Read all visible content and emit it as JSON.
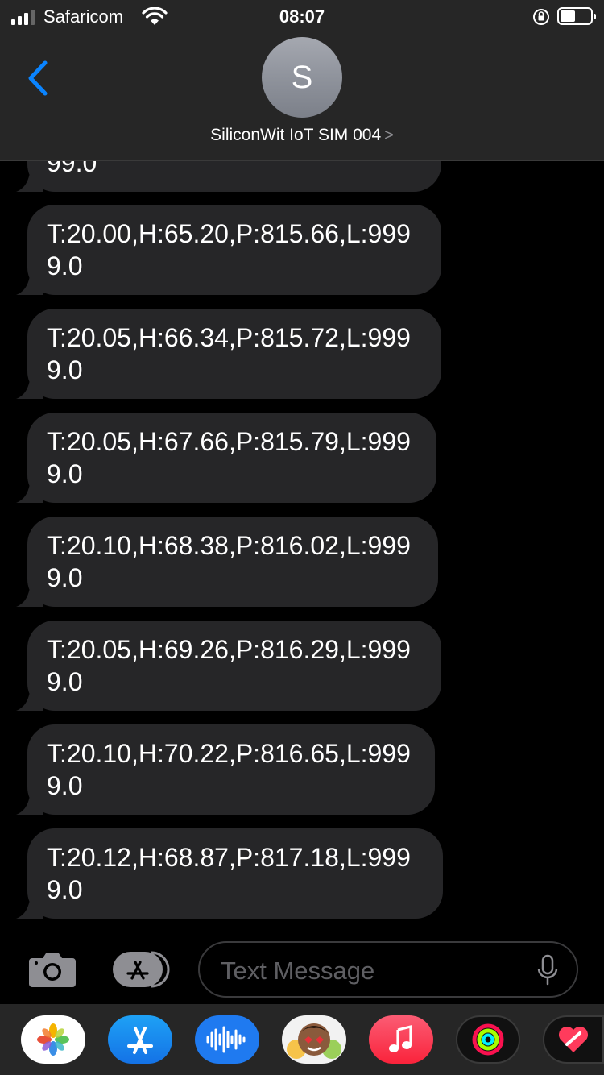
{
  "status_bar": {
    "carrier": "Safaricom",
    "time": "08:07",
    "battery_level": 0.5
  },
  "header": {
    "avatar_letter": "S",
    "contact_name": "SiliconWit IoT SIM 004",
    "contact_chevron": ">"
  },
  "messages": [
    {
      "text": "99.0"
    },
    {
      "text": "T:20.00,H:65.20,P:815.66,L:9999.0"
    },
    {
      "text": "T:20.05,H:66.34,P:815.72,L:9999.0"
    },
    {
      "text": "T:20.05,H:67.66,P:815.79,L:9999.0"
    },
    {
      "text": "T:20.10,H:68.38,P:816.02,L:9999.0"
    },
    {
      "text": "T:20.05,H:69.26,P:816.29,L:9999.0"
    },
    {
      "text": "T:20.10,H:70.22,P:816.65,L:9999.0"
    },
    {
      "text": "T:20.12,H:68.87,P:817.18,L:9999.0"
    }
  ],
  "input": {
    "placeholder": "Text Message"
  },
  "icons": {
    "back": "chevron-left-icon",
    "camera": "camera-icon",
    "apps": "app-store-icon",
    "mic": "microphone-icon"
  },
  "app_drawer": [
    {
      "name": "photos-app-icon"
    },
    {
      "name": "app-store-app-icon"
    },
    {
      "name": "audio-app-icon"
    },
    {
      "name": "memoji-app-icon"
    },
    {
      "name": "music-app-icon"
    },
    {
      "name": "activity-app-icon"
    },
    {
      "name": "digital-touch-app-icon"
    }
  ],
  "colors": {
    "accent": "#0a84ff",
    "bubble": "#262628",
    "background": "#000000"
  }
}
